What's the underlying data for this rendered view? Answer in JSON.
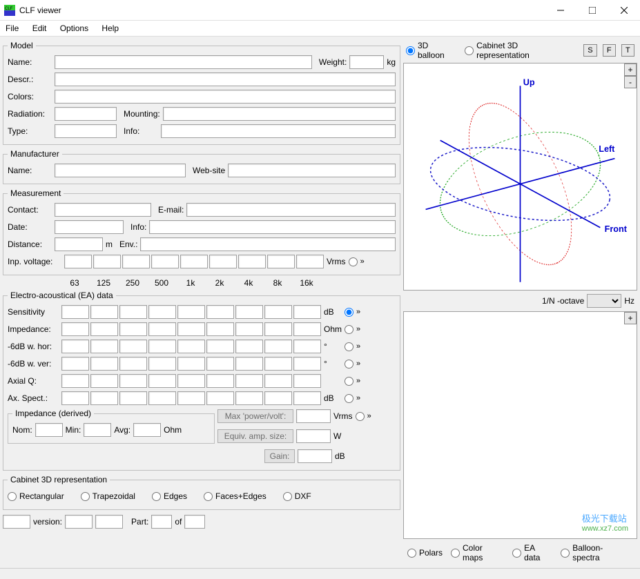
{
  "window": {
    "title": "CLF viewer"
  },
  "menu": {
    "file": "File",
    "edit": "Edit",
    "options": "Options",
    "help": "Help"
  },
  "model": {
    "legend": "Model",
    "name_lbl": "Name:",
    "name": "",
    "weight_lbl": "Weight:",
    "weight": "",
    "weight_unit": "kg",
    "descr_lbl": "Descr.:",
    "descr": "",
    "colors_lbl": "Colors:",
    "colors": "",
    "radiation_lbl": "Radiation:",
    "radiation": "",
    "mounting_lbl": "Mounting:",
    "mounting": "",
    "type_lbl": "Type:",
    "type": "",
    "info_lbl": "Info:",
    "info": ""
  },
  "manufacturer": {
    "legend": "Manufacturer",
    "name_lbl": "Name:",
    "name": "",
    "website_lbl": "Web-site",
    "website": ""
  },
  "measurement": {
    "legend": "Measurement",
    "contact_lbl": "Contact:",
    "contact": "",
    "email_lbl": "E-mail:",
    "email": "",
    "date_lbl": "Date:",
    "date": "",
    "info_lbl": "Info:",
    "info": "",
    "distance_lbl": "Distance:",
    "distance": "",
    "distance_unit": "m",
    "env_lbl": "Env.:",
    "env": "",
    "inpvolt_lbl": "Inp. voltage:",
    "inpvolt_unit": "Vrms"
  },
  "freq_headers": [
    "63",
    "125",
    "250",
    "500",
    "1k",
    "2k",
    "4k",
    "8k",
    "16k"
  ],
  "ea": {
    "legend": "Electro-acoustical (EA) data",
    "sensitivity_lbl": "Sensitivity",
    "sensitivity_unit": "dB",
    "impedance_lbl": "Impedance:",
    "impedance_unit": "Ohm",
    "hor_lbl": "-6dB w. hor:",
    "hor_unit": "°",
    "ver_lbl": "-6dB w. ver:",
    "ver_unit": "°",
    "axq_lbl": "Axial Q:",
    "axq_unit": "",
    "axsp_lbl": "Ax. Spect.:",
    "axsp_unit": "dB",
    "impderived": {
      "legend": "Impedance (derived)",
      "nom_lbl": "Nom:",
      "min_lbl": "Min:",
      "avg_lbl": "Avg:",
      "ohm": "Ohm"
    },
    "maxpower_lbl": "Max 'power/volt':",
    "maxpower_unit": "Vrms",
    "equiv_lbl": "Equiv. amp. size:",
    "equiv_unit": "W",
    "gain_lbl": "Gain:",
    "gain_unit": "dB"
  },
  "cab3d": {
    "legend": "Cabinet 3D representation",
    "rect": "Rectangular",
    "trap": "Trapezoidal",
    "edges": "Edges",
    "facesedges": "Faces+Edges",
    "dxf": "DXF"
  },
  "bottom": {
    "version_lbl": "version:",
    "part_lbl": "Part:",
    "of_lbl": "of"
  },
  "view3d": {
    "balloon": "3D balloon",
    "cabrep": "Cabinet 3D representation",
    "s": "S",
    "f": "F",
    "t": "T",
    "up": "Up",
    "left": "Left",
    "front": "Front"
  },
  "octave": {
    "label": "1/N -octave",
    "hz": "Hz"
  },
  "bottomtabs": {
    "polars": "Polars",
    "colormaps": "Color maps",
    "eadata": "EA data",
    "balloonspectra": "Balloon-spectra"
  },
  "watermark": {
    "zh": "极光下载站",
    "url": "www.xz7.com"
  }
}
